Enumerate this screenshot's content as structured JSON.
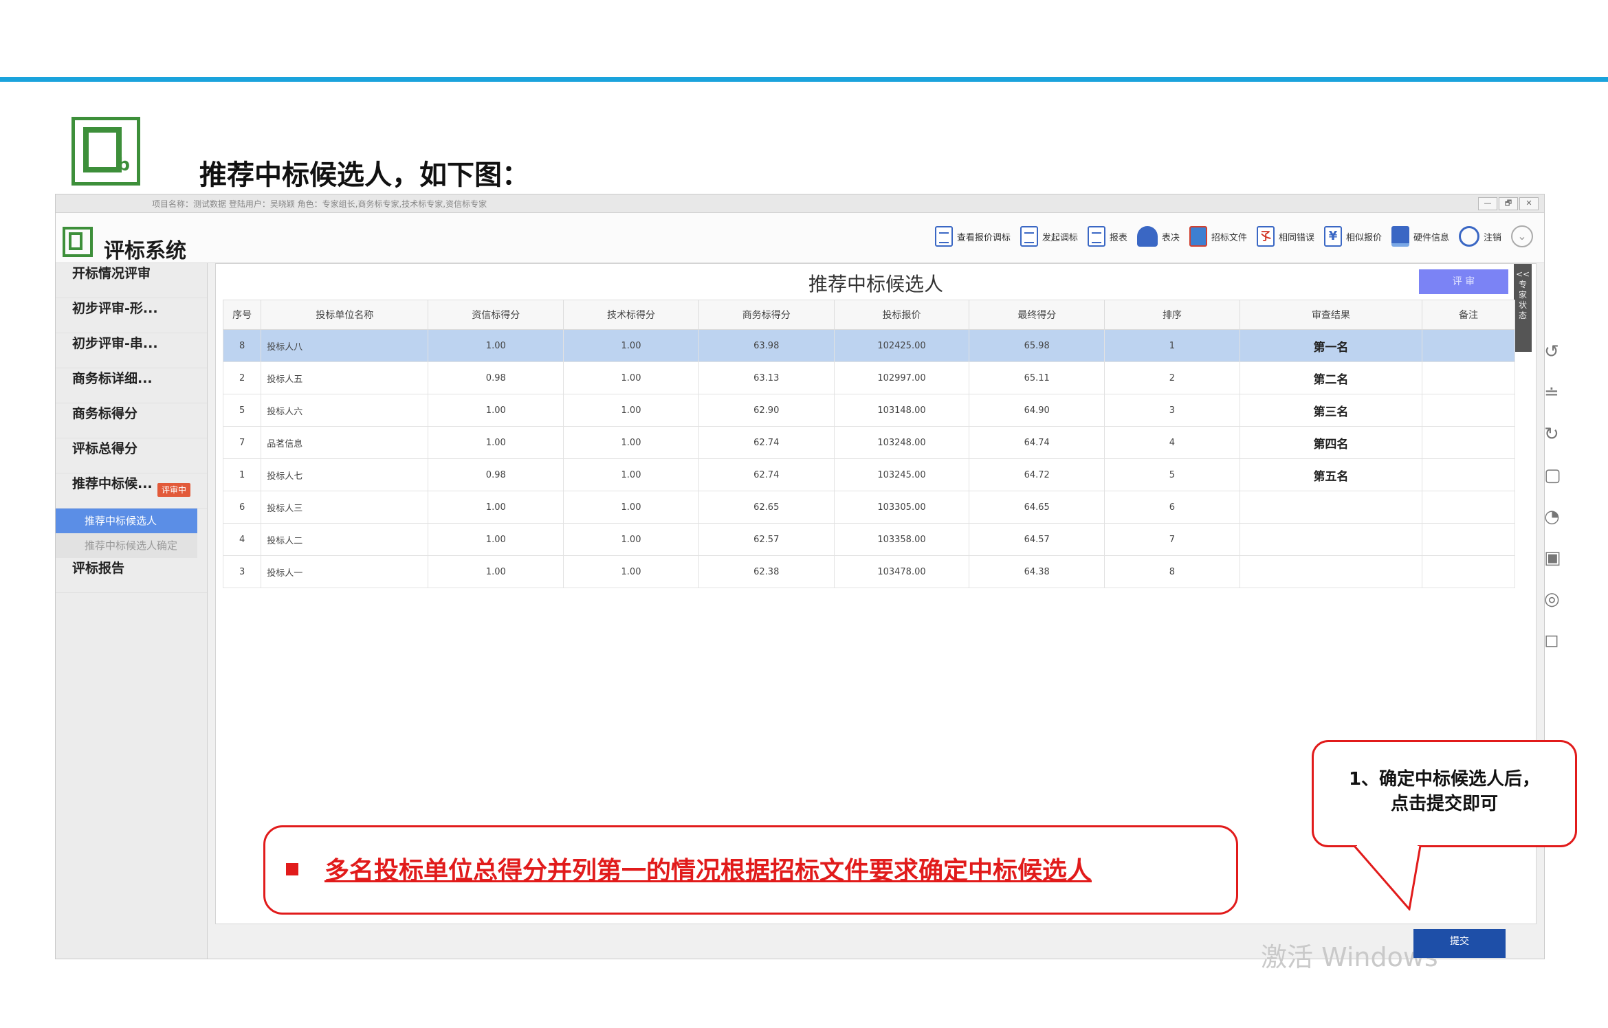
{
  "slide": {
    "title": "推荐中标候选人，如下图："
  },
  "app": {
    "info_bar": "项目名称：测试数据 登陆用户：吴晓颖 角色：专家组长,商务标专家,技术标专家,资信标专家",
    "name": "评标系统",
    "window_buttons": [
      "—",
      "🗗",
      "✕"
    ],
    "toolbar": [
      {
        "label": "查看报价调标",
        "icon": "doc-icon"
      },
      {
        "label": "发起调标",
        "icon": "doc-icon"
      },
      {
        "label": "报表",
        "icon": "doc-icon"
      },
      {
        "label": "表决",
        "icon": "user-icon"
      },
      {
        "label": "招标文件",
        "icon": "book-icon"
      },
      {
        "label": "相同错误",
        "icon": "signature-icon"
      },
      {
        "label": "相似报价",
        "icon": "yen-icon"
      },
      {
        "label": "硬件信息",
        "icon": "computer-icon"
      },
      {
        "label": "注销",
        "icon": "power-icon"
      }
    ]
  },
  "sidebar": {
    "items": [
      {
        "label": "开标情况评审"
      },
      {
        "label": "初步评审-形..."
      },
      {
        "label": "初步评审-串..."
      },
      {
        "label": "商务标详细..."
      },
      {
        "label": "商务标得分"
      },
      {
        "label": "评标总得分"
      },
      {
        "label": "推荐中标候...",
        "badge": "评审中"
      }
    ],
    "sub_items": [
      {
        "label": "推荐中标候选人",
        "active": true
      },
      {
        "label": "推荐中标候选人确定",
        "active": false
      }
    ],
    "last_item": "评标报告"
  },
  "main": {
    "title": "推荐中标候选人",
    "eval_button": "评 审",
    "side_tab": "<< 专 家 状 态",
    "columns": [
      "序号",
      "投标单位名称",
      "资信标得分",
      "技术标得分",
      "商务标得分",
      "投标报价",
      "最终得分",
      "排序",
      "审查结果",
      "备注"
    ],
    "rows": [
      {
        "no": "8",
        "name": "投标人八",
        "c1": "1.00",
        "c2": "1.00",
        "c3": "63.98",
        "price": "102425.00",
        "final": "65.98",
        "rank": "1",
        "result": "第一名",
        "note": ""
      },
      {
        "no": "2",
        "name": "投标人五",
        "c1": "0.98",
        "c2": "1.00",
        "c3": "63.13",
        "price": "102997.00",
        "final": "65.11",
        "rank": "2",
        "result": "第二名",
        "note": ""
      },
      {
        "no": "5",
        "name": "投标人六",
        "c1": "1.00",
        "c2": "1.00",
        "c3": "62.90",
        "price": "103148.00",
        "final": "64.90",
        "rank": "3",
        "result": "第三名",
        "note": ""
      },
      {
        "no": "7",
        "name": "品茗信息",
        "c1": "1.00",
        "c2": "1.00",
        "c3": "62.74",
        "price": "103248.00",
        "final": "64.74",
        "rank": "4",
        "result": "第四名",
        "note": ""
      },
      {
        "no": "1",
        "name": "投标人七",
        "c1": "0.98",
        "c2": "1.00",
        "c3": "62.74",
        "price": "103245.00",
        "final": "64.72",
        "rank": "5",
        "result": "第五名",
        "note": ""
      },
      {
        "no": "6",
        "name": "投标人三",
        "c1": "1.00",
        "c2": "1.00",
        "c3": "62.65",
        "price": "103305.00",
        "final": "64.65",
        "rank": "6",
        "result": "",
        "note": ""
      },
      {
        "no": "4",
        "name": "投标人二",
        "c1": "1.00",
        "c2": "1.00",
        "c3": "62.57",
        "price": "103358.00",
        "final": "64.57",
        "rank": "7",
        "result": "",
        "note": ""
      },
      {
        "no": "3",
        "name": "投标人一",
        "c1": "1.00",
        "c2": "1.00",
        "c3": "62.38",
        "price": "103478.00",
        "final": "64.38",
        "rank": "8",
        "result": "",
        "note": ""
      }
    ]
  },
  "annotations": {
    "red_note": "多名投标单位总得分并列第一的情况根据招标文件要求确定中标候选人",
    "bubble_line1": "1、确定中标候选人后，",
    "bubble_line2": "点击提交即可"
  },
  "submit_label": "提交",
  "watermark": "激活 Windows",
  "colors": {
    "accent_line": "#1aa3dc",
    "logo_green": "#3d8f3a",
    "selected_row": "#bdd3f0",
    "annotation_red": "#e11b1b",
    "submit_blue": "#1e4fa8"
  }
}
